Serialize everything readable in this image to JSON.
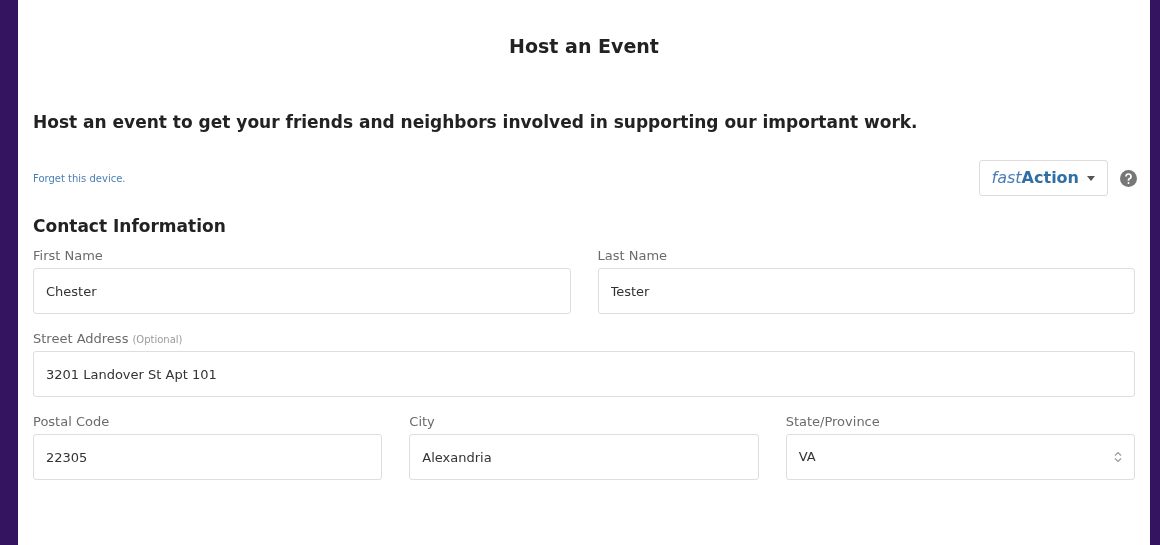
{
  "title": "Host an Event",
  "intro": "Host an event to get your friends and neighbors involved in supporting our important work.",
  "forget_link": "Forget this device.",
  "fast_action": {
    "prefix": "fast",
    "name": "Action"
  },
  "section": "Contact Information",
  "rows": [
    [
      {
        "kind": "text",
        "label": "First Name",
        "value": "Chester"
      },
      {
        "kind": "text",
        "label": "Last Name",
        "value": "Tester"
      }
    ],
    [
      {
        "kind": "text",
        "label": "Street Address",
        "note": "(Optional)",
        "value": "3201 Landover St Apt 101"
      }
    ],
    [
      {
        "kind": "text",
        "label": "Postal Code",
        "value": "22305"
      },
      {
        "kind": "text",
        "label": "City",
        "value": "Alexandria"
      },
      {
        "kind": "select",
        "label": "State/Province",
        "value": "VA"
      }
    ]
  ]
}
